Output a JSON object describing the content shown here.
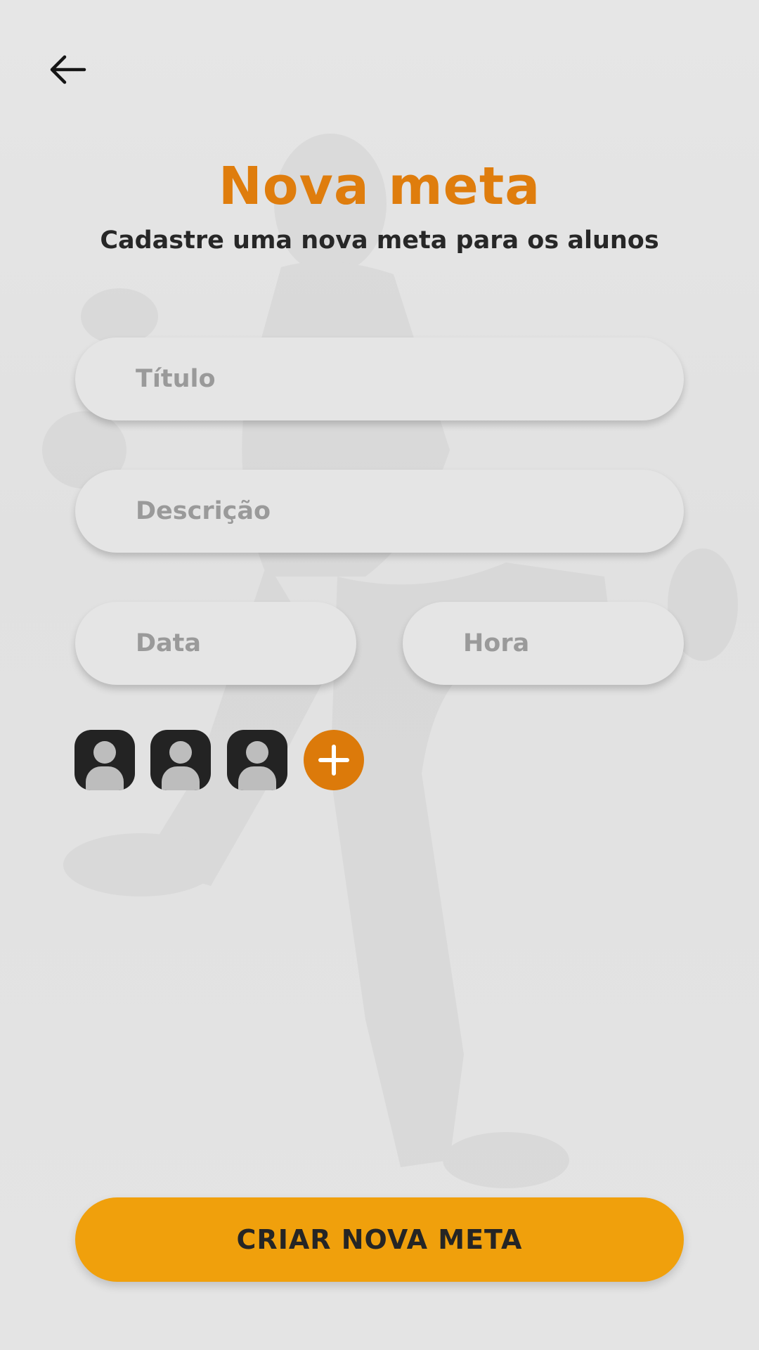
{
  "header": {
    "title": "Nova meta",
    "subtitle": "Cadastre uma nova meta para os alunos"
  },
  "form": {
    "titulo_placeholder": "Título",
    "descricao_placeholder": "Descrição",
    "data_placeholder": "Data",
    "hora_placeholder": "Hora"
  },
  "students": {
    "avatars": [
      "student",
      "student",
      "student"
    ]
  },
  "actions": {
    "submit_label": "CRIAR NOVA META"
  },
  "colors": {
    "accent_orange": "#df7d0d",
    "button_orange": "#f0a00c",
    "avatar_dark": "#232323",
    "background": "#e3e3e3"
  },
  "icons": {
    "back": "arrow-left-icon",
    "add": "plus-icon",
    "avatar": "user-icon"
  }
}
